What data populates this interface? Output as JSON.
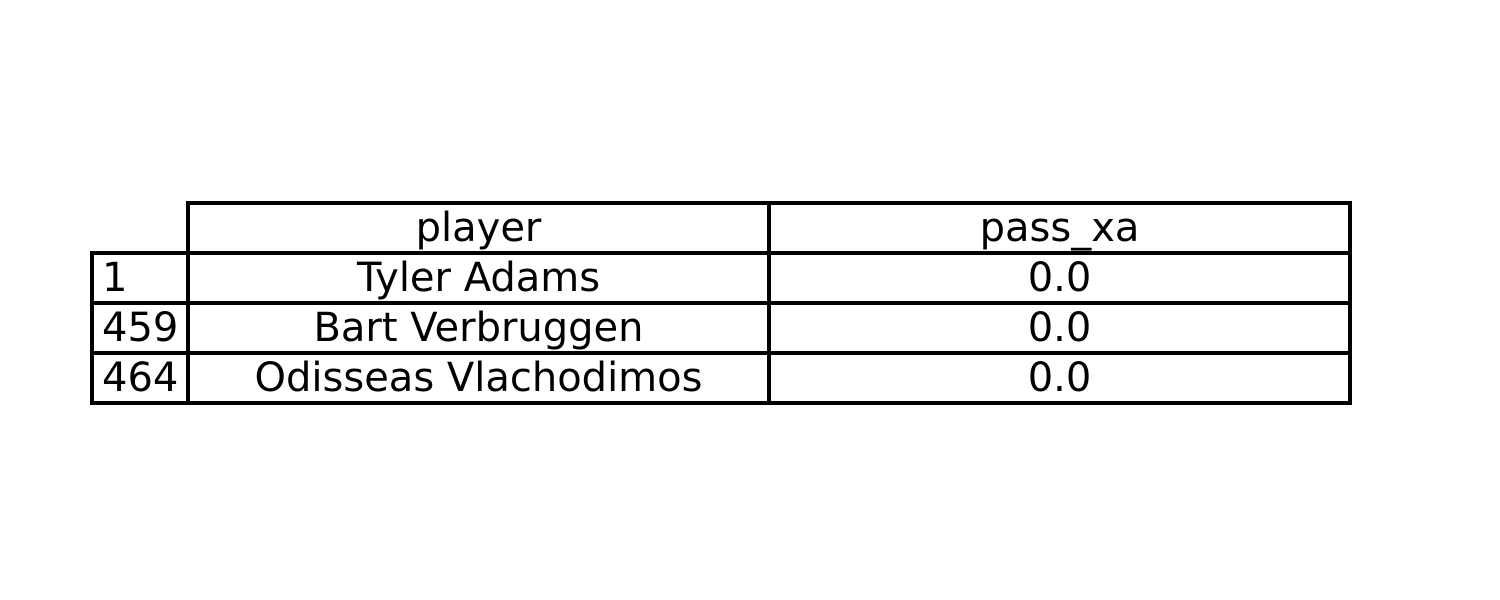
{
  "chart_data": {
    "type": "table",
    "columns": [
      "player",
      "pass_xa"
    ],
    "rows": [
      {
        "index": "1",
        "cells": [
          "Tyler Adams",
          "0.0"
        ]
      },
      {
        "index": "459",
        "cells": [
          "Bart Verbruggen",
          "0.0"
        ]
      },
      {
        "index": "464",
        "cells": [
          "Odisseas Vlachodimos",
          "0.0"
        ]
      }
    ],
    "border_color": "#000000",
    "background_color": "#ffffff"
  }
}
